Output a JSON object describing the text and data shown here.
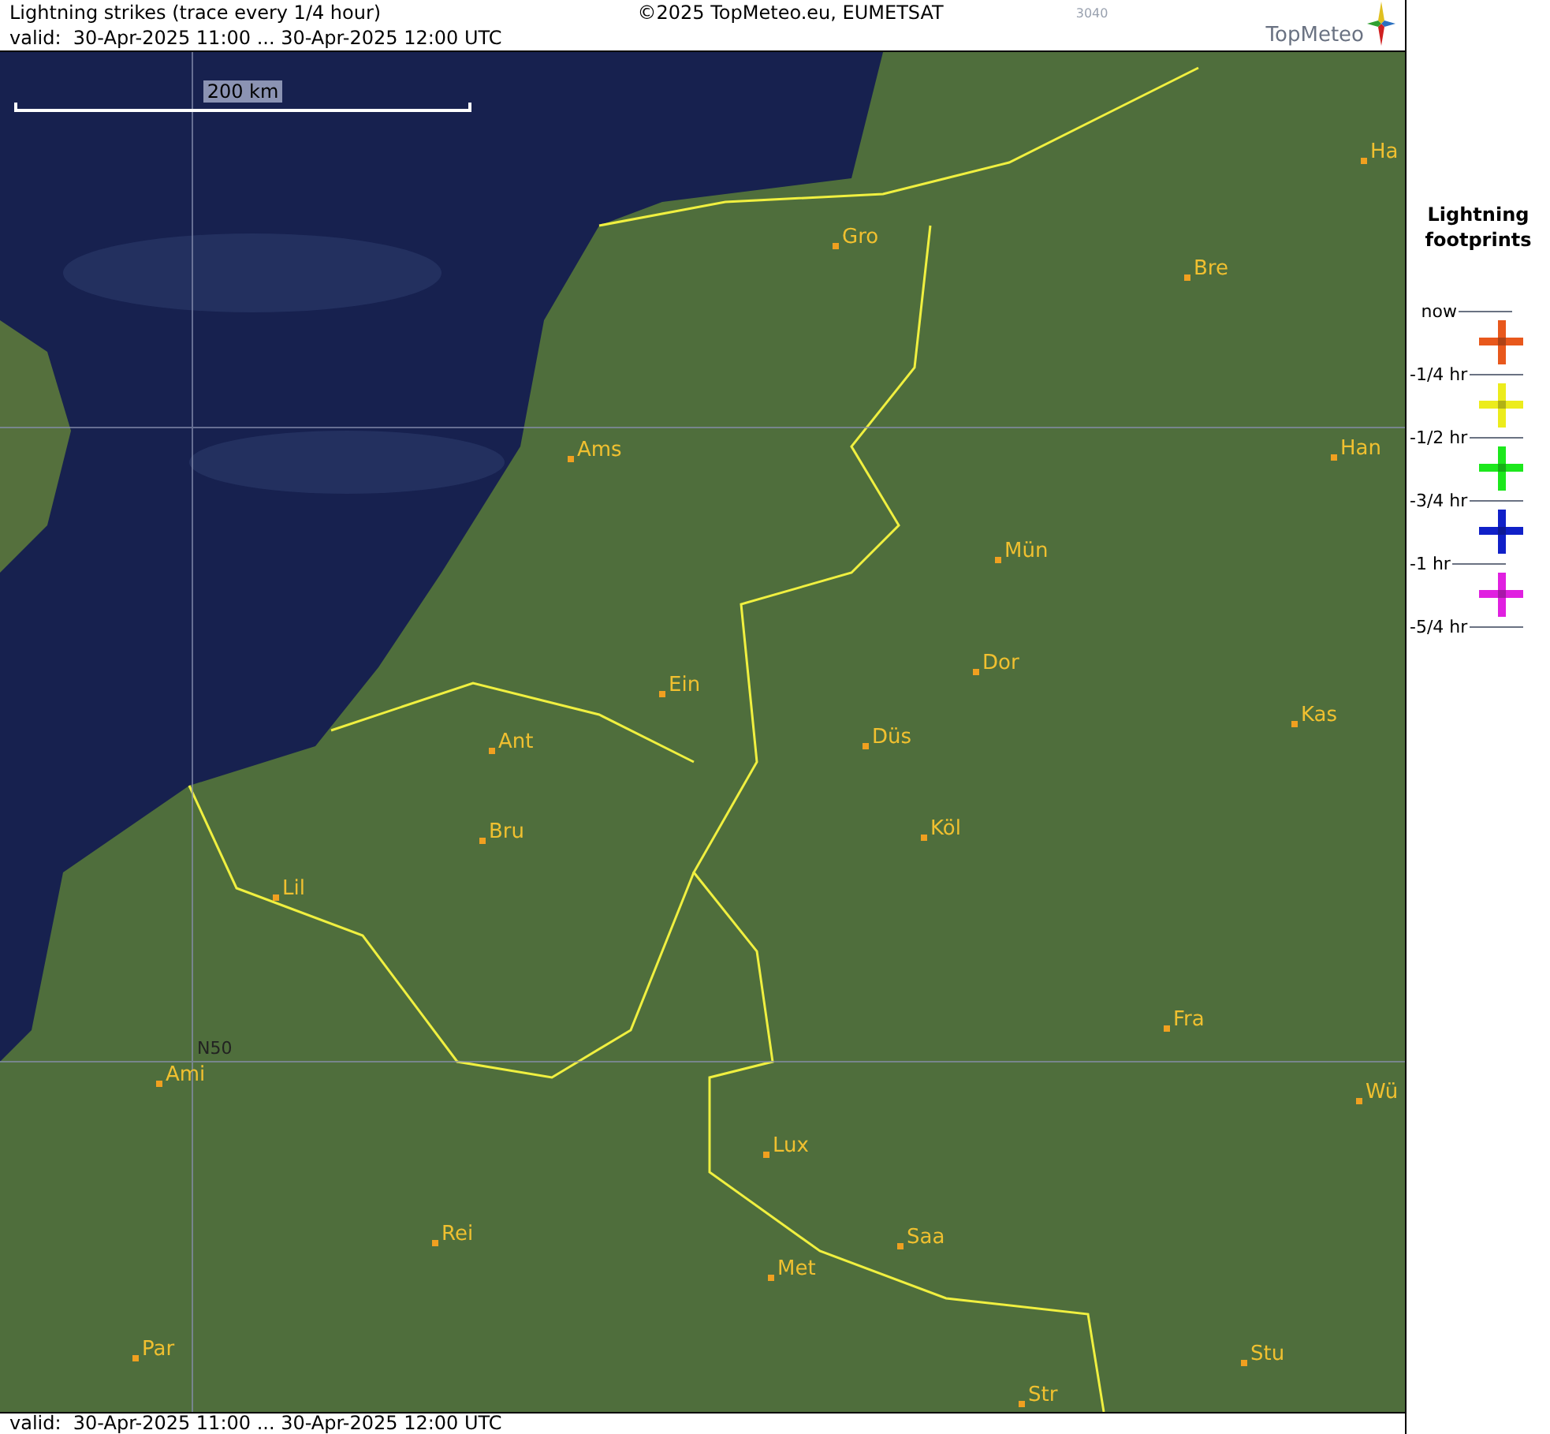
{
  "header": {
    "title": "Lightning strikes (trace every 1/4 hour)",
    "copyright": "©2025 TopMeteo.eu, EUMETSAT",
    "code": "3040",
    "valid": "valid:  30-Apr-2025 11:00 ... 30-Apr-2025 12:00 UTC",
    "logo_text": "TopMeteo"
  },
  "map": {
    "scale_label": "200 km",
    "grid_label": "N50",
    "cities": [
      "Gro",
      "Bre",
      "Ha",
      "Ams",
      "Han",
      "Mün",
      "Dor",
      "Ein",
      "Kas",
      "Düs",
      "Ant",
      "Köl",
      "Bru",
      "Lil",
      "Fra",
      "Ami",
      "Wü",
      "Lux",
      "Rei",
      "Saa",
      "Met",
      "Par",
      "Stu",
      "Str"
    ]
  },
  "footer": {
    "valid": "valid:  30-Apr-2025 11:00 ... 30-Apr-2025 12:00 UTC"
  },
  "legend": {
    "title": "Lightning footprints",
    "scale_labels": [
      "now",
      "-1/4 hr",
      "-1/2 hr",
      "-3/4 hr",
      "-1 hr",
      "-5/4 hr"
    ],
    "markers": [
      {
        "color": "#e8581c"
      },
      {
        "color": "#ecec1c"
      },
      {
        "color": "#1ce81c"
      },
      {
        "color": "#1020c8"
      },
      {
        "color": "#e020e0"
      }
    ]
  }
}
